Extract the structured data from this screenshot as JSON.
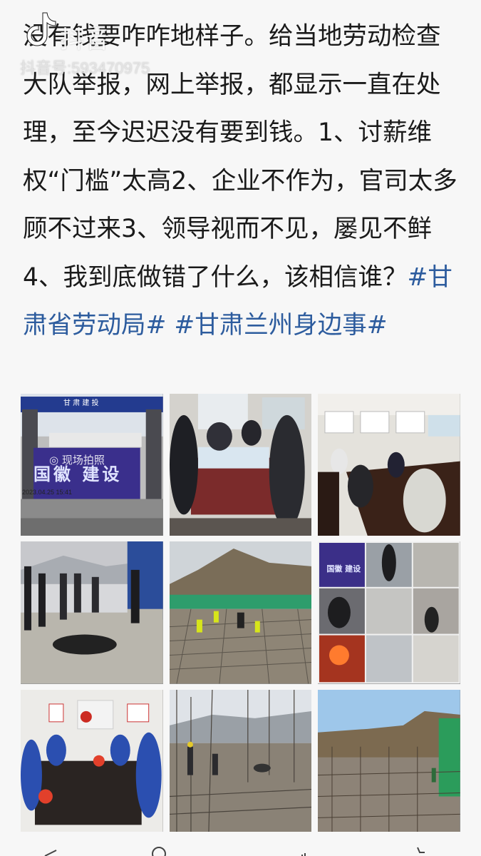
{
  "watermark": {
    "brand": "抖音",
    "id": "抖音号:593470975",
    "logo_icon": "tiktok-note-icon"
  },
  "post": {
    "text": "没有钱要咋咋地样子。给当地劳动检查大队举报，网上举报，都显示一直在处理，至今迟迟没有要到钱。1、讨薪维权“门槛”太高2、企业不作为，官司太多顾不过来3、领导视而不见，屡见不鲜4、我到底做错了什么，该相信谁？",
    "hashtags": [
      "#甘肃省劳动局#",
      "#甘肃兰州身边事#"
    ],
    "hashtag_color": "#2d5c9e"
  },
  "photos": {
    "p1": {
      "header": "甘 肃 建 投",
      "banner": "国徽 建设",
      "overlay": "◎ 现场拍照",
      "date": "2023.04.25 15:41"
    },
    "p6": {
      "banner": "国徽 建设"
    }
  },
  "bottom_bar": {
    "items": [
      {
        "icon": "share-icon"
      },
      {
        "icon": "comment-icon"
      },
      {
        "icon": "like-icon"
      },
      {
        "icon": "favorite-icon"
      }
    ]
  }
}
